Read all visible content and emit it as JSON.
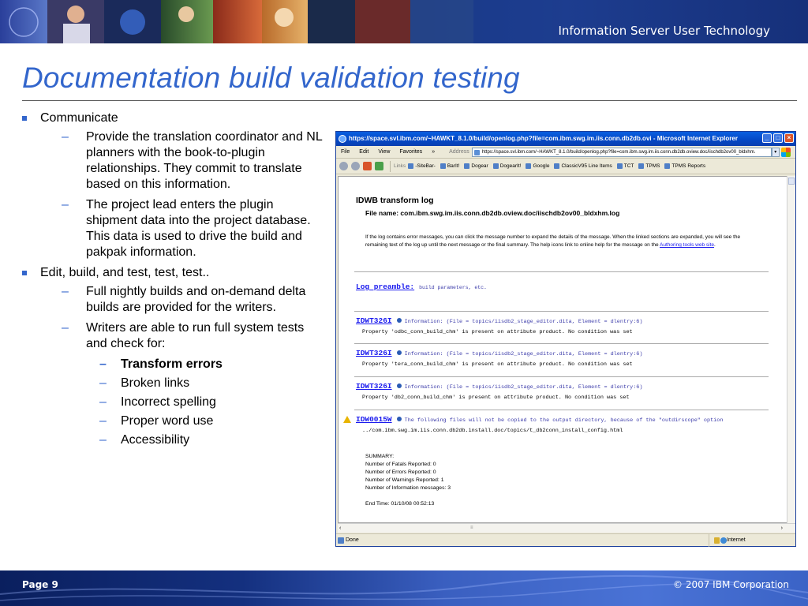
{
  "header": {
    "banner_title": "Information Server User Technology"
  },
  "slide": {
    "title": "Documentation build validation testing",
    "bullets": [
      {
        "text": "Communicate",
        "sub": [
          "Provide the translation coordinator and NL planners with the book-to-plugin relationships. They commit to translate based on this information.",
          "The project lead enters the plugin shipment data into the project database. This data is used to drive the build and pakpak information."
        ]
      },
      {
        "text": "Edit, build, and test, test, test..",
        "sub": [
          "Full nightly builds and on-demand delta builds are provided for the writers.",
          "Writers are able to run full system tests and check for:"
        ],
        "checks": [
          "Transform errors",
          "Broken links",
          "Incorrect spelling",
          "Proper word use",
          "Accessibility"
        ]
      }
    ]
  },
  "browser": {
    "window_title": "https://space.svl.ibm.com/~HAWKT_8.1.0/build/openlog.php?file=com.ibm.swg.im.iis.conn.db2db.ovi - Microsoft Internet Explorer",
    "menu": [
      "File",
      "Edit",
      "View",
      "Favorites"
    ],
    "menu_more": "»",
    "address_label": "Address",
    "address_value": "https://space.svl.ibm.com/~HAWKT_8.1.0/build/openlog.php?file=com.ibm.swg.im.iis.conn.db2db.oview.doc/iischdb2ov00_bldxhm.",
    "links_label": "Links",
    "links": [
      "-SiteBar-",
      "BarIt!",
      "Dogear",
      "DogearIt!",
      "Google",
      "ClassicV95 Line Items",
      "TCT",
      "TPMS",
      "TPMS Reports"
    ],
    "page": {
      "heading": "IDWB transform log",
      "file_name": "File name: com.ibm.swg.im.iis.conn.db2db.oview.doc/iischdb2ov00_bldxhm.log",
      "intro": "If the log contains error messages, you can click the message number to expand the details of the message. When the linked sections are expanded, you will see the remaining text of the log up until the next message or the final summary. The help icons link to online help for the message on the",
      "intro_link": "Authoring tools web site",
      "intro_end": ".",
      "preamble_link": "Log preamble:",
      "preamble_desc": "build parameters, etc.",
      "messages": [
        {
          "code": "IDWT326I",
          "head": "Information: (File = topics/iisdb2_stage_editor.dita, Element = dlentry:6)",
          "body": "Property 'odbc_conn_build_chm' is present on attribute product. No condition was set"
        },
        {
          "code": "IDWT326I",
          "head": "Information: (File = topics/iisdb2_stage_editor.dita, Element = dlentry:6)",
          "body": "Property 'tera_conn_build_chm' is present on attribute product. No condition was set"
        },
        {
          "code": "IDWT326I",
          "head": "Information: (File = topics/iisdb2_stage_editor.dita, Element = dlentry:6)",
          "body": "Property 'db2_conn_build_chm' is present on attribute product. No condition was set"
        },
        {
          "code": "IDW0015W",
          "head": "The following files will not be copied to the output directory, because of the \"outdirscope\" option",
          "body": "../com.ibm.swg.im.iis.conn.db2db.install.doc/topics/t_db2conn_install_config.html"
        }
      ],
      "summary": [
        "SUMMARY:",
        "Number of Fatals Reported: 0",
        "Number of Errors Reported: 0",
        "Number of Warnings Reported: 1",
        "Number of Information messages: 3",
        "",
        "End Time: 01/10/08 00:52:13"
      ]
    },
    "status_text": "Done",
    "zone": "Internet"
  },
  "footer": {
    "page": "Page 9",
    "copyright": "© 2007 IBM Corporation"
  },
  "colors": {
    "title_blue": "#3366cc",
    "banner_navy": "#0b1f5c",
    "link_blue": "#1a1aee"
  }
}
